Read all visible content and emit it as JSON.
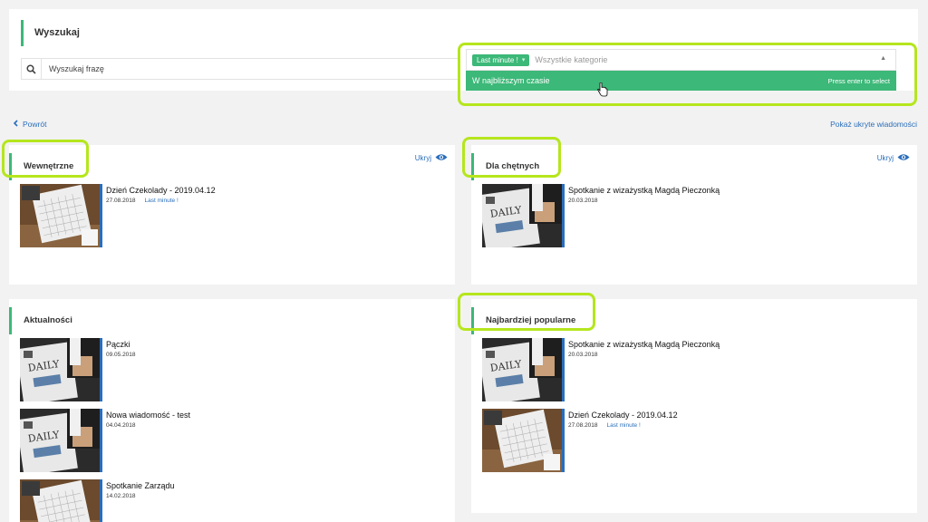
{
  "search": {
    "title": "Wyszukaj",
    "placeholder": "Wyszukaj frazę",
    "category_tag": "Last minute !",
    "category_placeholder": "Wszystkie kategorie",
    "dropdown_option": "W najbliższym czasie",
    "dropdown_hint": "Press enter to select"
  },
  "nav": {
    "back_label": "Powrót",
    "show_hidden_label": "Pokaż ukryte wiadomości"
  },
  "cards": {
    "internal": {
      "title": "Wewnętrzne",
      "hide_label": "Ukryj",
      "items": [
        {
          "title": "Dzień Czekolady - 2019.04.12",
          "date": "27.08.2018",
          "badge": "Last minute !",
          "image": "calendar"
        }
      ]
    },
    "volunteers": {
      "title": "Dla chętnych",
      "hide_label": "Ukryj",
      "items": [
        {
          "title": "Spotkanie z wizażystką Magdą Pieczonką",
          "date": "20.03.2018",
          "image": "newspaper"
        }
      ]
    },
    "news": {
      "title": "Aktualności",
      "items": [
        {
          "title": "Pączki",
          "date": "09.05.2018",
          "image": "newspaper"
        },
        {
          "title": "Nowa wiadomość - test",
          "date": "04.04.2018",
          "image": "newspaper"
        },
        {
          "title": "Spotkanie Zarządu",
          "date": "14.02.2018",
          "image": "calendar"
        }
      ]
    },
    "popular": {
      "title": "Najbardziej popularne",
      "items": [
        {
          "title": "Spotkanie z wizażystką Magdą Pieczonką",
          "date": "20.03.2018",
          "image": "newspaper"
        },
        {
          "title": "Dzień Czekolady - 2019.04.12",
          "date": "27.08.2018",
          "badge": "Last minute !",
          "image": "calendar"
        }
      ]
    }
  },
  "colors": {
    "accent": "#3cb878",
    "link": "#2a6ebb",
    "highlight": "#b5e61d"
  }
}
